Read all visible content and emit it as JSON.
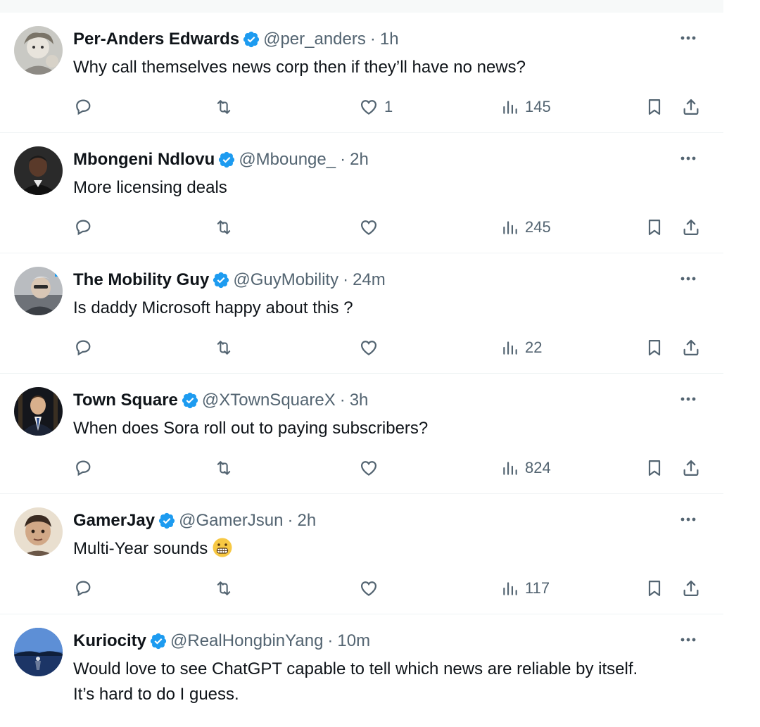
{
  "tweets": [
    {
      "name": "Per-Anders Edwards",
      "handle": "@per_anders",
      "time": "1h",
      "text": "Why call themselves news corp then if they’ll have no news?",
      "likes": "1",
      "views": "145"
    },
    {
      "name": "Mbongeni Ndlovu",
      "handle": "@Mbounge_",
      "time": "2h",
      "text": "More licensing deals",
      "likes": "",
      "views": "245"
    },
    {
      "name": "The Mobility Guy",
      "handle": "@GuyMobility",
      "time": "24m",
      "text": "Is daddy Microsoft happy about this ?",
      "likes": "",
      "views": "22"
    },
    {
      "name": "Town Square",
      "handle": "@XTownSquareX",
      "time": "3h",
      "text": "When does Sora roll out to paying subscribers?",
      "likes": "",
      "views": "824"
    },
    {
      "name": "GamerJay",
      "handle": "@GamerJsun",
      "time": "2h",
      "text": "Multi-Year sounds",
      "emoji": "grimacing-face",
      "likes": "",
      "views": "117"
    },
    {
      "name": "Kuriocity",
      "handle": "@RealHongbinYang",
      "time": "10m",
      "text_line1": "Would love to see ChatGPT capable to tell which news are reliable by itself.",
      "text_line2": "It’s hard to do I guess."
    }
  ],
  "separator": "·",
  "icons": {
    "reply": "reply-icon",
    "retweet": "retweet-icon",
    "like": "heart-icon",
    "views": "views-icon",
    "bookmark": "bookmark-icon",
    "share": "share-icon",
    "more": "more-icon",
    "verified": "verified-badge-icon"
  },
  "colors": {
    "verified": "#1d9bf0",
    "text": "#0f1419",
    "secondary": "#536471",
    "divider": "#eff3f4"
  }
}
